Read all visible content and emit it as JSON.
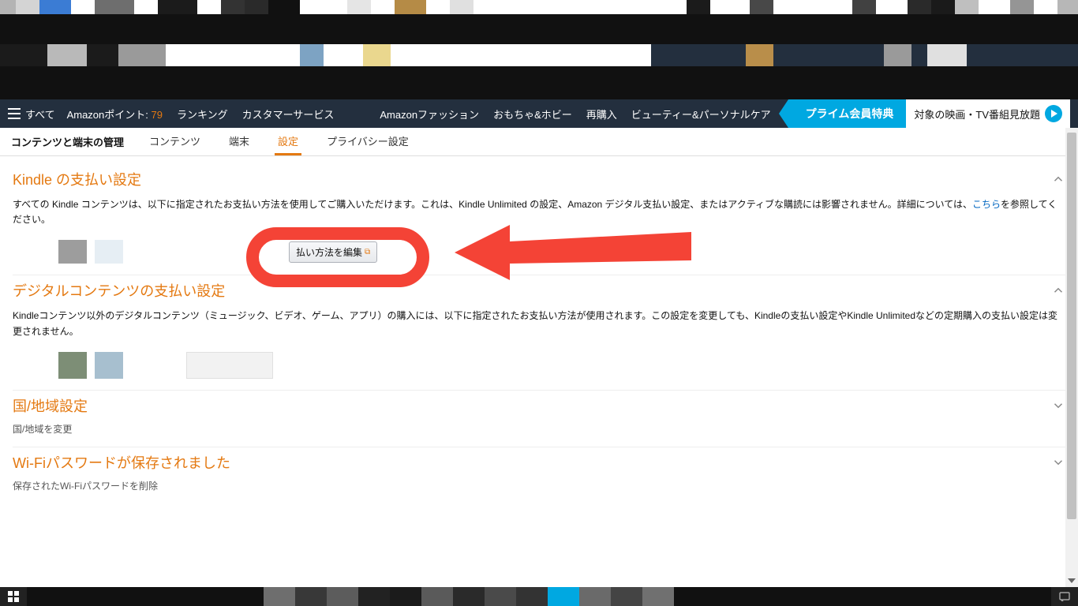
{
  "nav": {
    "all_label": "すべて",
    "points_label_prefix": "Amazonポイント:",
    "points_value": "79",
    "items": [
      "ランキング",
      "カスタマーサービス",
      "Amazonファッション",
      "おもちゃ&ホビー",
      "再購入",
      "ビューティー&パーソナルケア"
    ],
    "prime_ribbon": "プライム会員特典",
    "prime_side": "対象の映画・TV番組見放題"
  },
  "subtabs": {
    "title": "コンテンツと端末の管理",
    "items": [
      {
        "label": "コンテンツ",
        "active": false
      },
      {
        "label": "端末",
        "active": false
      },
      {
        "label": "設定",
        "active": true
      },
      {
        "label": "プライバシー設定",
        "active": false
      }
    ]
  },
  "sections": {
    "kindle_pay": {
      "title": "Kindle の支払い設定",
      "desc_pre": "すべての Kindle コンテンツは、以下に指定されたお支払い方法を使用してご購入いただけます。これは、Kindle Unlimited の設定、Amazon デジタル支払い設定、またはアクティブな購読には影響されません。詳細については、",
      "desc_link": "こちら",
      "desc_post": "を参照してください。",
      "edit_button": "払い方法を編集"
    },
    "digital_pay": {
      "title": "デジタルコンテンツの支払い設定",
      "desc": "Kindleコンテンツ以外のデジタルコンテンツ（ミュージック、ビデオ、ゲーム、アプリ）の購入には、以下に指定されたお支払い方法が使用されます。この設定を変更しても、Kindleの支払い設定やKindle Unlimitedなどの定期購入の支払い設定は変更されません。"
    },
    "region": {
      "title": "国/地域設定",
      "sub": "国/地域を変更"
    },
    "wifi": {
      "title": "Wi-Fiパスワードが保存されました",
      "sub": "保存されたWi-Fiパスワードを削除"
    }
  }
}
